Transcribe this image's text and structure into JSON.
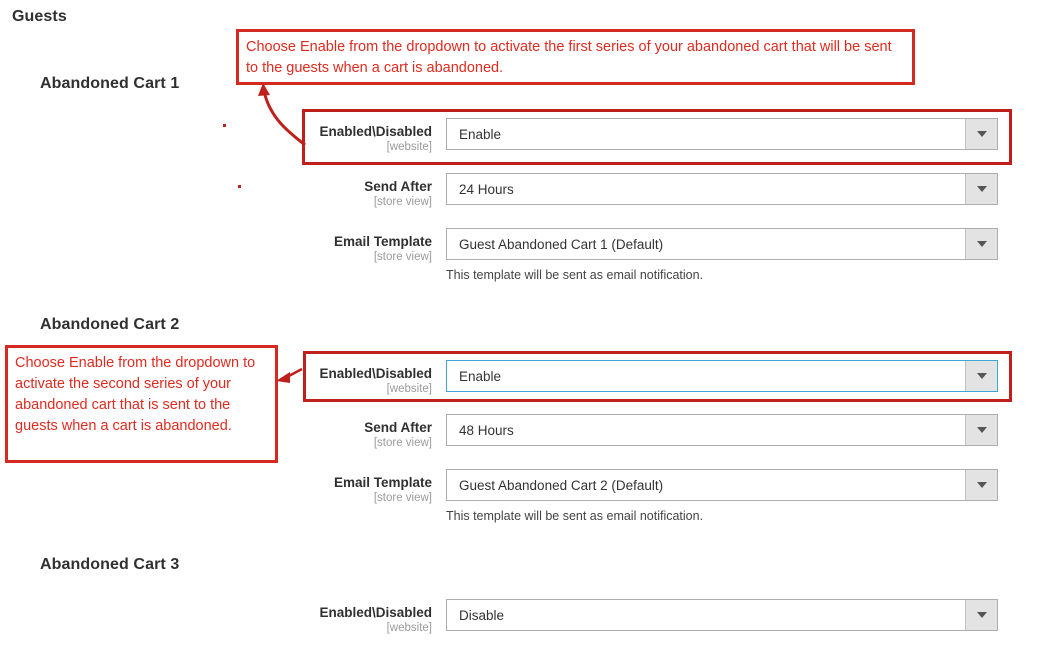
{
  "page": {
    "heading": "Guests"
  },
  "colors": {
    "annotation_red": "#e02b20",
    "highlight_red": "#c0201b",
    "focus_blue": "#41a6d4",
    "heading_text": "#303030",
    "scope_text": "#9b9b9b"
  },
  "sections": [
    {
      "title": "Abandoned Cart 1",
      "fields": [
        {
          "label": "Enabled\\Disabled",
          "scope": "[website]",
          "value": "Enable",
          "icon": "chevron-down-icon",
          "note": ""
        },
        {
          "label": "Send After",
          "scope": "[store view]",
          "value": "24 Hours",
          "icon": "chevron-down-icon",
          "note": ""
        },
        {
          "label": "Email Template",
          "scope": "[store view]",
          "value": "Guest Abandoned Cart 1 (Default)",
          "icon": "chevron-down-icon",
          "note": "This template will be sent as email notification."
        }
      ]
    },
    {
      "title": "Abandoned Cart 2",
      "fields": [
        {
          "label": "Enabled\\Disabled",
          "scope": "[website]",
          "value": "Enable",
          "icon": "chevron-down-icon",
          "note": ""
        },
        {
          "label": "Send After",
          "scope": "[store view]",
          "value": "48 Hours",
          "icon": "chevron-down-icon",
          "note": ""
        },
        {
          "label": "Email Template",
          "scope": "[store view]",
          "value": "Guest Abandoned Cart 2 (Default)",
          "icon": "chevron-down-icon",
          "note": "This template will be sent as email notification."
        }
      ]
    },
    {
      "title": "Abandoned Cart 3",
      "fields": [
        {
          "label": "Enabled\\Disabled",
          "scope": "[website]",
          "value": "Disable",
          "icon": "chevron-down-icon",
          "note": ""
        }
      ]
    }
  ],
  "annotations": [
    {
      "text": "Choose Enable from the dropdown to activate the first series of your abandoned cart that will be sent to the guests when a cart is abandoned."
    },
    {
      "text": "Choose Enable from the dropdown to activate the second series of your abandoned cart that is sent to the guests when a cart is abandoned."
    }
  ]
}
